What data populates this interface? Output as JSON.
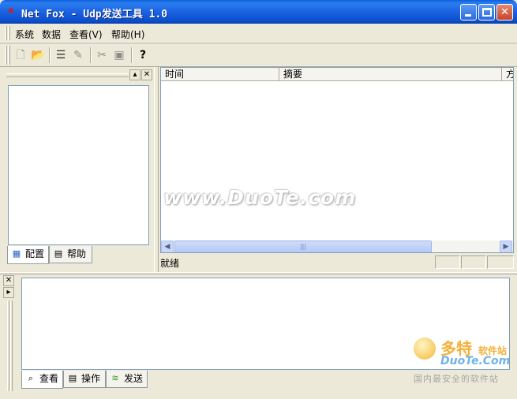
{
  "window": {
    "title": "Net Fox - Udp发送工具 1.0",
    "app_icon": "netfox-icon",
    "controls": {
      "minimize": "",
      "maximize": "",
      "close": "✕"
    }
  },
  "menu": [
    {
      "label": "系统"
    },
    {
      "label": "数据"
    },
    {
      "label": "查看(V)"
    },
    {
      "label": "帮助(H)"
    }
  ],
  "toolbar": {
    "buttons": [
      {
        "icon": "new-file-icon",
        "glyph": "🗋"
      },
      {
        "icon": "open-folder-icon",
        "glyph": "📂"
      },
      {
        "icon": "sort-list-icon",
        "glyph": "☰"
      },
      {
        "icon": "edit-icon",
        "glyph": "✎"
      },
      {
        "icon": "cut-icon",
        "glyph": "✂"
      },
      {
        "icon": "save-icon",
        "glyph": "▣"
      },
      {
        "icon": "help-icon",
        "glyph": "?"
      }
    ]
  },
  "left_panel": {
    "pin": "▴",
    "close": "✕",
    "tabs": [
      {
        "label": "配置",
        "icon": "config-icon",
        "glyph": "▦"
      },
      {
        "label": "帮助",
        "icon": "document-icon",
        "glyph": "▤"
      }
    ]
  },
  "list_view": {
    "columns": [
      "时间",
      "摘要",
      "方"
    ],
    "scroll_left": "◀",
    "scroll_right": "▶",
    "thumb_grip": "|||"
  },
  "status_bar": {
    "text": "就绪"
  },
  "bottom_panel": {
    "close": "✕",
    "pin": "▸",
    "tabs": [
      {
        "label": "查看",
        "icon": "magnifier-icon",
        "glyph": "⌕"
      },
      {
        "label": "操作",
        "icon": "document-icon",
        "glyph": "▤"
      },
      {
        "label": "发送",
        "icon": "send-icon",
        "glyph": "≋"
      }
    ]
  },
  "watermark": {
    "text": "www.DuoTe.com",
    "logo_main": "多特",
    "logo_small": "软件站",
    "logo_domain": "DuoTe.Com",
    "logo_sub": "国内最安全的软件站"
  }
}
